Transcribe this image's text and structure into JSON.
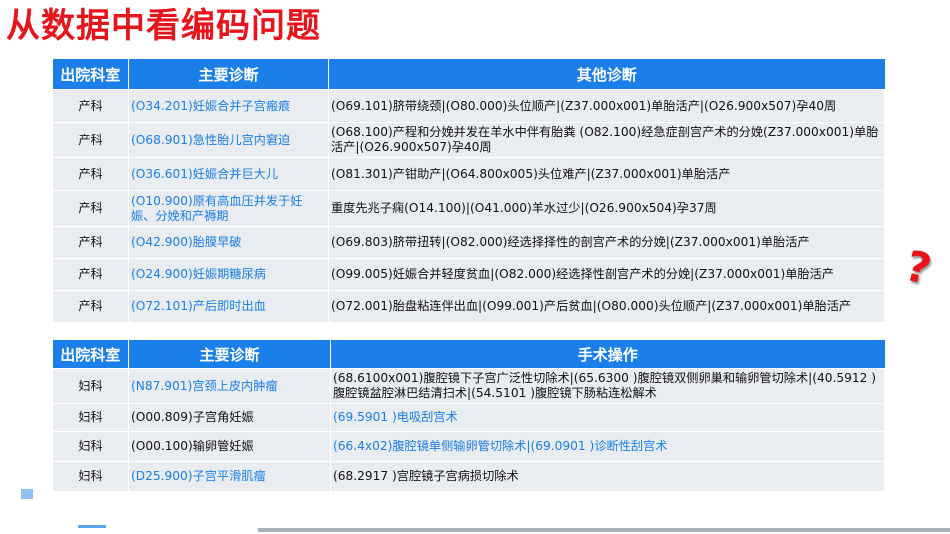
{
  "title": "从数据中看编码问题",
  "table1": {
    "headers": [
      "出院科室",
      "主要诊断",
      "其他诊断"
    ],
    "rows": [
      {
        "dept": "产科",
        "main": "(O34.201)妊娠合并子宫瘢痕",
        "other": "(O69.101)脐带绕颈|(O80.000)头位顺产|(Z37.000x001)单胎活产|(O26.900x507)孕40周"
      },
      {
        "dept": "产科",
        "main": "(O68.901)急性胎儿宫内窘迫",
        "other": "(O68.100)产程和分娩并发在羊水中伴有胎粪 (O82.100)经急症剖宫产术的分娩(Z37.000x001)单胎活产|(O26.900x507)孕40周"
      },
      {
        "dept": "产科",
        "main": "(O36.601)妊娠合并巨大儿",
        "other": "(O81.301)产钳助产|(O64.800x005)头位难产|(Z37.000x001)单胎活产"
      },
      {
        "dept": "产科",
        "main": "(O10.900)原有高血压并发于妊娠、分娩和产褥期",
        "other": "重度先兆子痫(O14.100)|(O41.000)羊水过少|(O26.900x504)孕37周"
      },
      {
        "dept": "产科",
        "main": "(O42.900)胎膜早破",
        "other": "(O69.803)脐带扭转|(O82.000)经选择择性的剖宫产术的分娩|(Z37.000x001)单胎活产"
      },
      {
        "dept": "产科",
        "main": "(O24.900)妊娠期糖尿病",
        "other": "(O99.005)妊娠合并轻度贫血|(O82.000)经选择性剖宫产术的分娩|(Z37.000x001)单胎活产"
      },
      {
        "dept": "产科",
        "main": "(O72.101)产后即时出血",
        "other": "(O72.001)胎盘粘连伴出血|(O99.001)产后贫血|(O80.000)头位顺产|(Z37.000x001)单胎活产"
      }
    ]
  },
  "table2": {
    "headers": [
      "出院科室",
      "主要诊断",
      "手术操作"
    ],
    "rows": [
      {
        "dept": "妇科",
        "main": "(N87.901)宫颈上皮内肿瘤",
        "other": "(68.6100x001)腹腔镜下子宫广泛性切除术|(65.6300 )腹腔镜双侧卵巢和输卵管切除术|(40.5912 )腹腔镜盆腔淋巴结清扫术|(54.5101 )腹腔镜下肠粘连松解术"
      },
      {
        "dept": "妇科",
        "main": "(O00.809)子宫角妊娠",
        "other": "(69.5901 )电吸刮宫术"
      },
      {
        "dept": "妇科",
        "main": "(O00.100)输卵管妊娠",
        "other": "(66.4x02)腹腔镜单侧输卵管切除术|(69.0901 )诊断性刮宫术"
      },
      {
        "dept": "妇科",
        "main": "(D25.900)子宫平滑肌瘤",
        "other": "(68.2917 )宫腔镜子宫病损切除术"
      }
    ]
  },
  "decor": {
    "question_mark": "?"
  },
  "colors": {
    "title": "#e8141b",
    "header_bg": "#1a7fe8",
    "cell_bg": "#e9ecf0",
    "link_text": "#1a7fe8"
  }
}
